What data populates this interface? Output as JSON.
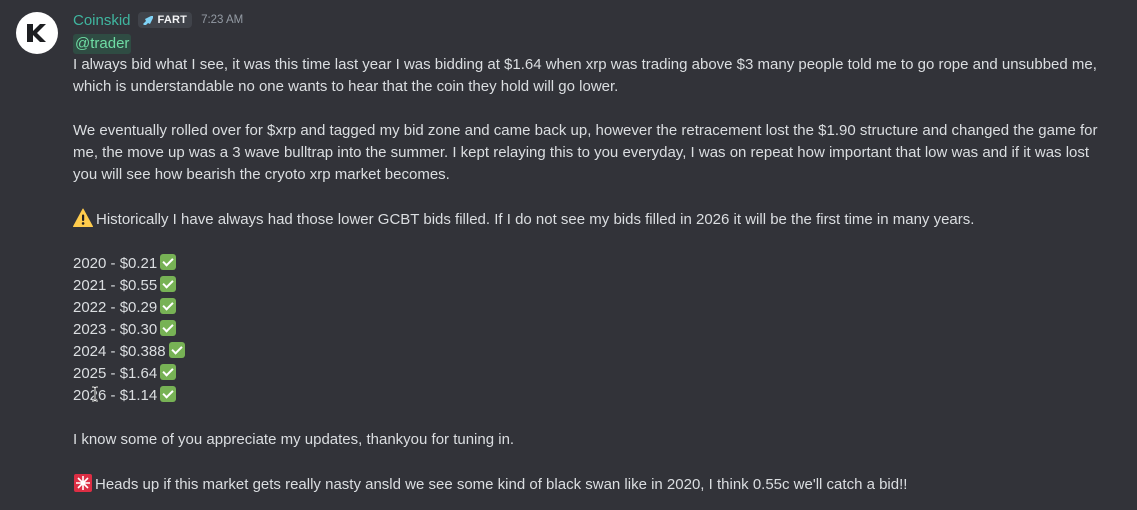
{
  "message": {
    "author": "Coinskid",
    "role_tag": "FART",
    "timestamp": "7:23 AM",
    "mention": "@trader",
    "paragraph_1": "I always bid what I see, it was this time last year I was bidding at $1.64 when xrp was trading above $3 many people told me to go rope and unsubbed me, which is understandable no one wants to hear that the coin they hold will go lower.",
    "paragraph_2": "We eventually rolled over for $xrp and tagged my bid zone and came back up, however the retracement lost the $1.90 structure and changed the game for me, the move up was a 3 wave bulltrap into the summer. I kept relaying this to you everyday, I was on repeat how important that low was and if it was lost you will see how bearish the cryoto xrp market becomes.",
    "warning_line": "Historically I have always had those lower GCBT bids filled. If I do not see my bids filled in 2026 it will be the first time in many years.",
    "bids": [
      "2020 - $0.21",
      "2021 - $0.55",
      "2022 - $0.29",
      "2023 - $0.30",
      "2024 - $0.388",
      "2025 - $1.64",
      "2026 - $1.14"
    ],
    "thanks_line": "I know some of you appreciate my updates, thankyou for tuning in.",
    "alert_line": "Heads up if this market gets really nasty ansld we see some kind of black swan like in 2020,  I think 0.55c we'll catch a bid!!"
  },
  "icons": {
    "avatar": "ck-logo-icon",
    "tag": "rocket-icon",
    "warning": "warning-icon",
    "check": "check-mark-icon",
    "alert": "rotating-light-icon"
  },
  "colors": {
    "background": "#323339",
    "username": "#3fb59f",
    "mention_text": "#6fdca4",
    "check": "#77b255"
  }
}
